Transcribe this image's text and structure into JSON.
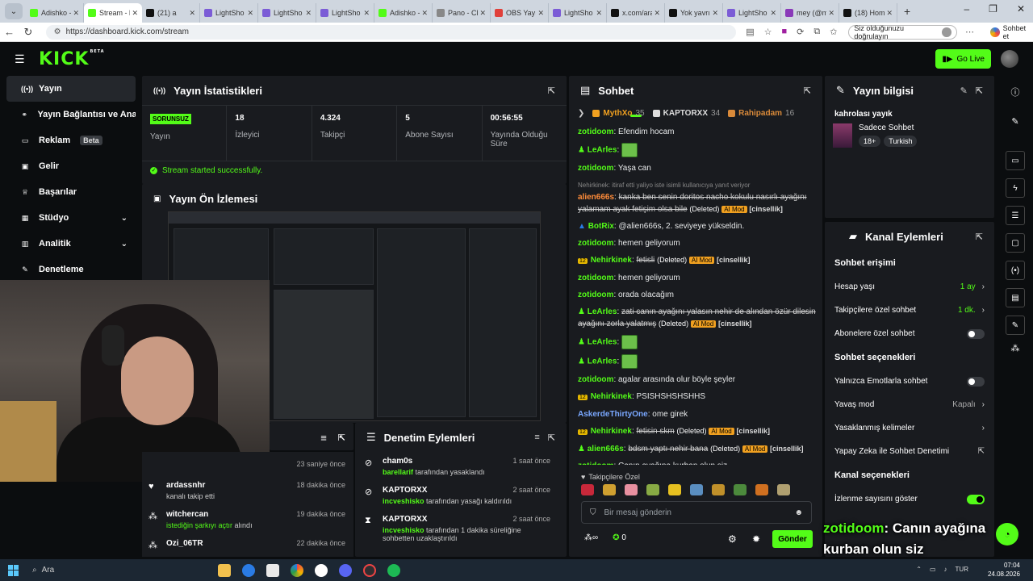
{
  "browser": {
    "tabs": [
      {
        "title": "Adishko -",
        "color": "#53fc18"
      },
      {
        "title": "Stream - k",
        "color": "#53fc18",
        "active": true
      },
      {
        "title": "(21) a",
        "color": "#111111"
      },
      {
        "title": "LightSho",
        "color": "#7b5cd6"
      },
      {
        "title": "LightSho",
        "color": "#7b5cd6"
      },
      {
        "title": "LightSho",
        "color": "#7b5cd6"
      },
      {
        "title": "Adishko -",
        "color": "#53fc18"
      },
      {
        "title": "Pano - Cl",
        "color": "#888888"
      },
      {
        "title": "OBS Yayın",
        "color": "#e0403a"
      },
      {
        "title": "LightSho",
        "color": "#7b5cd6"
      },
      {
        "title": "x.com/ara",
        "color": "#111111"
      },
      {
        "title": "Yok yavrı",
        "color": "#111111"
      },
      {
        "title": "LightSho",
        "color": "#7b5cd6"
      },
      {
        "title": "mey (@m",
        "color": "#8a3ab9"
      },
      {
        "title": "(18) Hom",
        "color": "#111111"
      }
    ],
    "url": "https://dashboard.kick.com/stream",
    "verify_label": "Siz olduğunuzu doğrulayın",
    "copilot_label": "Sohbet et"
  },
  "header": {
    "logo": "KICK",
    "logo_badge": "BETA",
    "go_live": "Go Live"
  },
  "sidebar": {
    "items": [
      {
        "label": "Yayın",
        "icon": "broadcast-icon",
        "glyph": "((•))"
      },
      {
        "label": "Yayın Bağlantısı ve Anahtar",
        "icon": "link-icon",
        "glyph": "⚭"
      },
      {
        "label": "Reklam",
        "icon": "tv-icon",
        "glyph": "▭",
        "badge": "Beta"
      },
      {
        "label": "Gelir",
        "icon": "wallet-icon",
        "glyph": "▣"
      },
      {
        "label": "Başarılar",
        "icon": "trophy-icon",
        "glyph": "♕"
      },
      {
        "label": "Stüdyo",
        "icon": "grid-icon",
        "glyph": "▦"
      },
      {
        "label": "Analitik",
        "icon": "chart-icon",
        "glyph": "▥"
      },
      {
        "label": "Denetleme",
        "icon": "wrench-icon",
        "glyph": "✎"
      }
    ]
  },
  "stats": {
    "title": "Yayın İstatistikleri",
    "status_badge": "SORUNSUZ",
    "status_label": "Yayın",
    "cells": [
      {
        "value": "18",
        "label": "İzleyici"
      },
      {
        "value": "4.324",
        "label": "Takipçi"
      },
      {
        "value": "5",
        "label": "Abone Sayısı"
      },
      {
        "value": "00:56:55",
        "label": "Yayında Olduğu Süre"
      }
    ],
    "success_message": "Stream started successfully."
  },
  "preview": {
    "title": "Yayın Ön İzlemesi"
  },
  "activity": {
    "first_time": "23 saniye önce",
    "rows": [
      {
        "name": "ardassnhr",
        "sub": "kanalı takip etti",
        "time": "18 dakika önce",
        "icon": "heart-icon",
        "glyph": "♥",
        "green": false
      },
      {
        "name": "witchercan",
        "sub": "istediğin şarkıyı açtır",
        "sub2": "alındı",
        "time": "19 dakika önce",
        "icon": "kick-points-icon",
        "glyph": "⁂",
        "green": true
      },
      {
        "name": "Ozi_06TR",
        "sub": "",
        "time": "22 dakika önce",
        "icon": "kick-points-icon",
        "glyph": "⁂",
        "green": false
      }
    ]
  },
  "moderation": {
    "title": "Denetim Eylemleri",
    "rows": [
      {
        "name": "cham0s",
        "actor": "barellarif",
        "text": "tarafından yasaklandı",
        "time": "1 saat önce",
        "icon": "ban-icon",
        "glyph": "⊘"
      },
      {
        "name": "KAPTORXX",
        "actor": "incveshisko",
        "text": "tarafından yasağı kaldırıldı",
        "time": "2 saat önce",
        "icon": "unban-icon",
        "glyph": "⊘"
      },
      {
        "name": "KAPTORXX",
        "actor": "incveshisko",
        "text": "tarafından 1 dakika süreliğine sohbetten uzaklaştırıldı",
        "time": "2 saat önce",
        "icon": "timeout-icon",
        "glyph": "⧗"
      }
    ]
  },
  "chat": {
    "title": "Sohbet",
    "top_gifters": [
      {
        "name": "MythXo",
        "count": "35",
        "color": "#f0a020"
      },
      {
        "name": "KAPTORXX",
        "count": "34",
        "color": "#dddddd"
      },
      {
        "name": "Rahipadam",
        "count": "16",
        "color": "#d98a3a"
      }
    ],
    "messages": [
      {
        "user": "zotidoom",
        "color": "#53fc18",
        "text": "Efendim hocam"
      },
      {
        "user": "LeArles",
        "color": "#53fc18",
        "text": "",
        "emote": true
      },
      {
        "user": "zotidoom",
        "color": "#53fc18",
        "text": "Yaşa can"
      },
      {
        "reply": "Nehirkinek: itiraf etti yaliyo iste isimli kullanıcıya yanıt veriyor",
        "user": "alien666s",
        "color": "#ff8c3a",
        "deleted": "kanka ben senin doritos nacho kokulu nasırlı ayağını yalamam ayak fetişim olsa bile",
        "mod": true
      },
      {
        "user": "BotRix",
        "color": "#53fc18",
        "text": "@alien666s, 2. seviyeye yükseldin."
      },
      {
        "user": "zotidoom",
        "color": "#53fc18",
        "text": "hemen geliyorum"
      },
      {
        "user": "Nehirkinek",
        "color": "#53fc18",
        "deleted": "fetisli",
        "mod": true
      },
      {
        "user": "zotidoom",
        "color": "#53fc18",
        "text": "hemen geliyorum"
      },
      {
        "user": "zotidoom",
        "color": "#53fc18",
        "text": "orada olacağım"
      },
      {
        "user": "LeArles",
        "color": "#53fc18",
        "deleted": "zati canın ayağını yalasın nehir de alından özür dilesin ayağını zorla yalatmış",
        "mod": true
      },
      {
        "user": "LeArles",
        "color": "#53fc18",
        "text": "",
        "emote": true
      },
      {
        "user": "LeArles",
        "color": "#53fc18",
        "text": "",
        "emote": true
      },
      {
        "user": "zotidoom",
        "color": "#53fc18",
        "text": "agalar arasında olur böyle şeyler"
      },
      {
        "user": "Nehirkinek",
        "color": "#53fc18",
        "text": "PSISHSHSHSHHS"
      },
      {
        "user": "AskerdeThirtyOne",
        "color": "#7aa8ff",
        "text": "ome girek"
      },
      {
        "user": "Nehirkinek",
        "color": "#53fc18",
        "deleted": "fetisin skm",
        "mod": true
      },
      {
        "user": "alien666s",
        "color": "#53fc18",
        "deleted": "bdsm yaptı nehir bana",
        "mod": true
      },
      {
        "user": "zotidoom",
        "color": "#53fc18",
        "text": "Canın ayağına kurban olun siz"
      }
    ],
    "deleted_label": "(Deleted)",
    "ai_mod_label": "AI Mod",
    "sexual_label": "[cinsellik]",
    "followers_only": "Takipçilere Özel",
    "input_placeholder": "Bir mesaj gönderin",
    "points": "0",
    "send_label": "Gönder"
  },
  "info": {
    "title": "Yayın bilgisi",
    "stream_title": "kahrolası yayık",
    "category": "Sadece Sohbet",
    "tags": [
      "18+",
      "Turkish"
    ]
  },
  "actions": {
    "title": "Kanal Eylemleri",
    "sections": [
      {
        "title": "Sohbet erişimi",
        "rows": [
          {
            "label": "Hesap yaşı",
            "value": "1 ay",
            "type": "link"
          },
          {
            "label": "Takipçilere özel sohbet",
            "value": "1 dk.",
            "type": "link"
          },
          {
            "label": "Abonelere özel sohbet",
            "type": "toggle",
            "on": false
          }
        ]
      },
      {
        "title": "Sohbet seçenekleri",
        "rows": [
          {
            "label": "Yalnızca Emotlarla sohbet",
            "type": "toggle",
            "on": false
          },
          {
            "label": "Yavaş mod",
            "value": "Kapalı",
            "type": "link-gray"
          },
          {
            "label": "Yasaklanmış kelimeler",
            "type": "arrow"
          },
          {
            "label": "Yapay Zeka ile Sohbet Denetimi",
            "type": "external"
          }
        ]
      },
      {
        "title": "Kanal seçenekleri",
        "rows": [
          {
            "label": "İzlenme sayısını göster",
            "type": "toggle",
            "on": true
          }
        ]
      }
    ]
  },
  "overlay": {
    "user": "zotidoom",
    "text": ": Canın ayağına kurban olun siz"
  },
  "taskbar": {
    "search": "Ara",
    "time": "07:04",
    "date": "24.08.2026",
    "lang": "TUR"
  }
}
